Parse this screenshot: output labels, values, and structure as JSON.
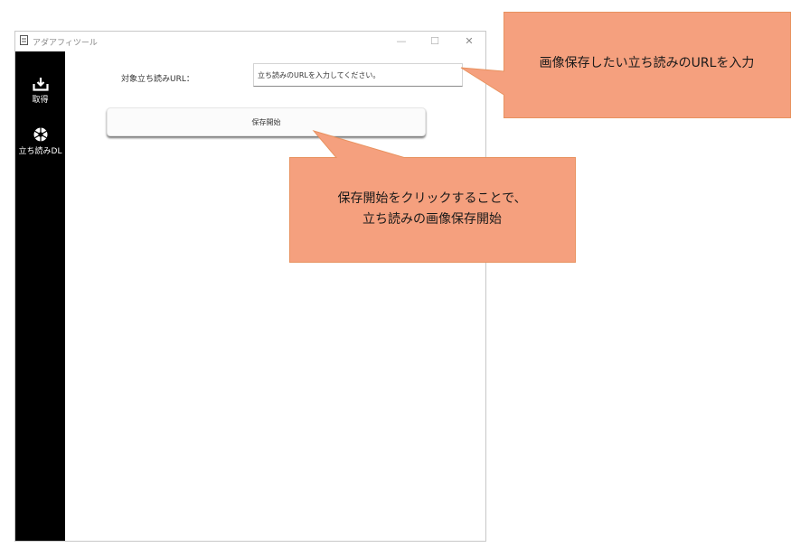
{
  "window": {
    "title": "アダアフィツール",
    "minimize": "—",
    "maximize": "☐",
    "close": "✕"
  },
  "sidebar": {
    "items": [
      {
        "label": "取得",
        "icon": "download-tray-icon"
      },
      {
        "label": "立ち読みDL",
        "icon": "camera-shutter-icon"
      }
    ]
  },
  "form": {
    "url_label": "対象立ち読みURL：",
    "url_placeholder": "立ち読みのURLを入力してください。",
    "start_button": "保存開始"
  },
  "callouts": {
    "url_hint": "画像保存したい立ち読みのURLを入力",
    "start_hint_line1": "保存開始をクリックすることで、",
    "start_hint_line2": "立ち読みの画像保存開始",
    "fill_color": "#f5a07e",
    "border_color": "#e8925f"
  },
  "colors": {
    "sidebar": "#000000",
    "window_bg": "#ffffff"
  }
}
